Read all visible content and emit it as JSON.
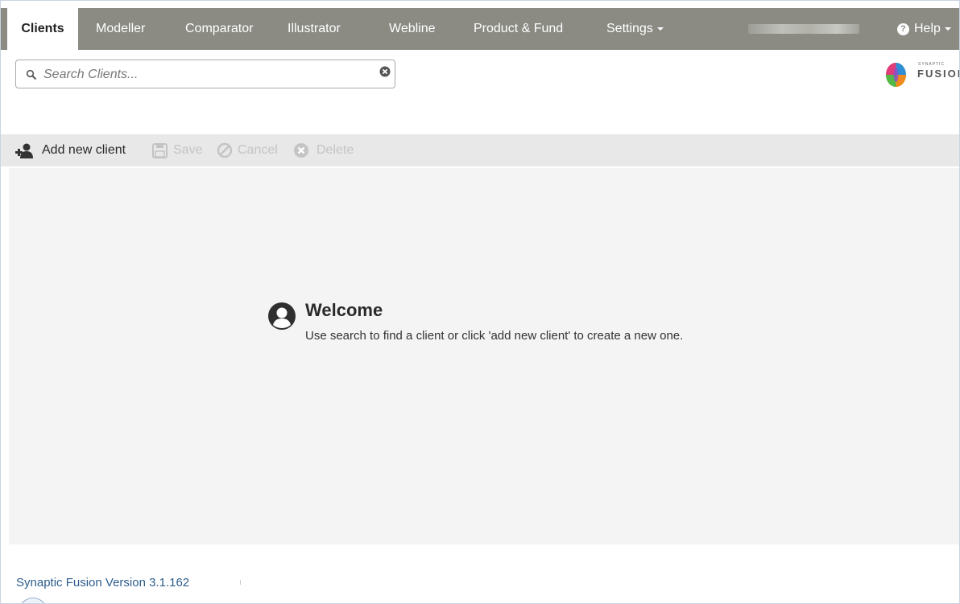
{
  "nav": {
    "tabs": [
      {
        "label": "Clients",
        "active": true
      },
      {
        "label": "Modeller"
      },
      {
        "label": "Comparator"
      },
      {
        "label": "Illustrator"
      },
      {
        "label": "Webline"
      },
      {
        "label": "Product & Fund"
      },
      {
        "label": "Settings"
      }
    ],
    "help_label": "Help",
    "help_icon": "question-circle-icon"
  },
  "search": {
    "placeholder": "Search Clients...",
    "value": "",
    "search_icon": "search-icon",
    "clear_icon": "clear-circle-icon"
  },
  "logo": {
    "small_text": "SYNAPTIC",
    "big_text": "FUSION"
  },
  "toolbar": {
    "add_label": "Add new client",
    "save_label": "Save",
    "cancel_label": "Cancel",
    "delete_label": "Delete"
  },
  "welcome": {
    "title": "Welcome",
    "text": "Use search to find a client or click 'add new client' to create a new one.",
    "icon": "user-circle-icon"
  },
  "footer": {
    "version": "Synaptic Fusion Version 3.1.162"
  },
  "colors": {
    "navbar": "#8b8b84",
    "toolbar": "#e8e8e8",
    "main_bg": "#f4f4f4",
    "version_link": "#2d5d8c"
  }
}
